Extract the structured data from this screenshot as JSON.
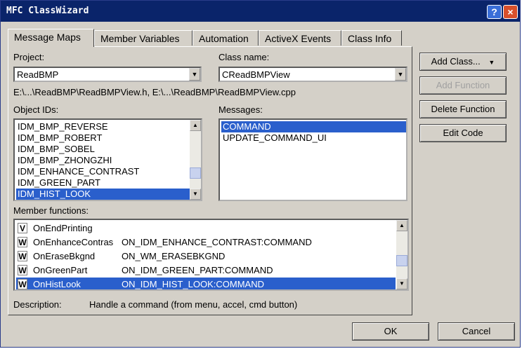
{
  "window": {
    "title": "MFC ClassWizard",
    "help_glyph": "?",
    "close_glyph": "×"
  },
  "tabs": [
    {
      "label": "Message Maps"
    },
    {
      "label": "Member Variables"
    },
    {
      "label": "Automation"
    },
    {
      "label": "ActiveX Events"
    },
    {
      "label": "Class Info"
    }
  ],
  "project": {
    "label": "Project:",
    "value": "ReadBMP"
  },
  "class_name": {
    "label": "Class name:",
    "value": "CReadBMPView"
  },
  "path_text": "E:\\...\\ReadBMP\\ReadBMPView.h, E:\\...\\ReadBMP\\ReadBMPView.cpp",
  "object_ids": {
    "label": "Object IDs:",
    "items": [
      "IDM_BMP_REVERSE",
      "IDM_BMP_ROBERT",
      "IDM_BMP_SOBEL",
      "IDM_BMP_ZHONGZHI",
      "IDM_ENHANCE_CONTRAST",
      "IDM_GREEN_PART",
      "IDM_HIST_LOOK"
    ],
    "selected_index": 6
  },
  "messages": {
    "label": "Messages:",
    "items": [
      "COMMAND",
      "UPDATE_COMMAND_UI"
    ],
    "selected_index": 0
  },
  "buttons": {
    "add_class": "Add Class...",
    "add_function": "Add Function",
    "delete_function": "Delete Function",
    "edit_code": "Edit Code",
    "ok": "OK",
    "cancel": "Cancel"
  },
  "member_functions": {
    "label": "Member functions:",
    "rows": [
      {
        "tag": "V",
        "name": "OnEndPrinting",
        "handler": ""
      },
      {
        "tag": "W",
        "name": "OnEnhanceContras",
        "handler": "ON_IDM_ENHANCE_CONTRAST:COMMAND"
      },
      {
        "tag": "W",
        "name": "OnEraseBkgnd",
        "handler": "ON_WM_ERASEBKGND"
      },
      {
        "tag": "W",
        "name": "OnGreenPart",
        "handler": "ON_IDM_GREEN_PART:COMMAND"
      },
      {
        "tag": "W",
        "name": "OnHistLook",
        "handler": "ON_IDM_HIST_LOOK:COMMAND"
      }
    ],
    "selected_index": 4
  },
  "description": {
    "label": "Description:",
    "text": "Handle a command (from menu, accel, cmd button)"
  },
  "colors": {
    "title_bar": "#0a246a",
    "selection": "#2a5fcc",
    "dialog_face": "#d4d0c8"
  }
}
